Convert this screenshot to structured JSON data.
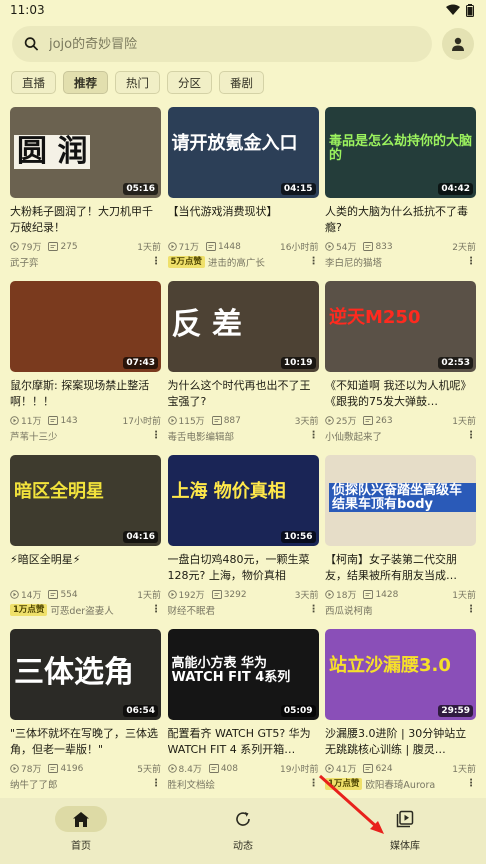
{
  "status": {
    "time": "11:03"
  },
  "search": {
    "placeholder": "jojo的奇妙冒险"
  },
  "chips": [
    "直播",
    "推荐",
    "热门",
    "分区",
    "番剧"
  ],
  "videos": [
    {
      "cap": "圆  润",
      "duration": "05:16",
      "title": "大粉耗子圆润了！大刀机甲千万破纪录！",
      "views": "79万",
      "comments": "275",
      "date": "1天前",
      "badge": "",
      "author": "武子弈",
      "bg": "#6b6250",
      "cap_color": "#111",
      "cap_bg": "#f4f1e6"
    },
    {
      "cap": "请开放氪金入口",
      "duration": "04:15",
      "title": "【当代游戏消费现状】",
      "views": "71万",
      "comments": "1448",
      "date": "16小时前",
      "badge": "5万点赞",
      "author": "进击的高广长",
      "bg": "#2c3f57",
      "cap_color": "#ffffff",
      "cap_bg": ""
    },
    {
      "cap": "毒品是怎么劫持你的大脑的",
      "duration": "04:42",
      "title": "人类的大脑为什么抵抗不了毒瘾?",
      "views": "54万",
      "comments": "833",
      "date": "2天前",
      "badge": "",
      "author": "李白尼的猫塔",
      "bg": "#243d3a",
      "cap_color": "#9bf25e",
      "cap_bg": ""
    },
    {
      "cap": "",
      "duration": "07:43",
      "title": "鼠尔摩斯: 探案现场禁止整活啊！！！",
      "views": "11万",
      "comments": "143",
      "date": "17小时前",
      "badge": "",
      "author": "芦苇十三少",
      "bg": "#7a3a1e",
      "cap_color": "#fff",
      "cap_bg": ""
    },
    {
      "cap": "反  差",
      "duration": "10:19",
      "title": "为什么这个时代再也出不了王宝强了?",
      "views": "115万",
      "comments": "887",
      "date": "3天前",
      "badge": "",
      "author": "毒舌电影编辑部",
      "bg": "#4d4234",
      "cap_color": "#ffffff",
      "cap_bg": ""
    },
    {
      "cap": "逆天M250",
      "duration": "02:53",
      "title": "《不知道啊 我还以为人机呢》《跟我的75发大弹鼓…",
      "views": "25万",
      "comments": "263",
      "date": "1天前",
      "badge": "",
      "author": "小仙敷起来了",
      "bg": "#5a5147",
      "cap_color": "#ff2a1f",
      "cap_bg": ""
    },
    {
      "cap": "暗区全明星",
      "duration": "04:16",
      "title": "⚡暗区全明星⚡",
      "views": "14万",
      "comments": "554",
      "date": "1天前",
      "badge": "1万点赞",
      "author": "可恶der盗妻人",
      "bg": "#3e3b2e",
      "cap_color": "#f2e33c",
      "cap_bg": ""
    },
    {
      "cap": "上海 物价真相",
      "duration": "10:56",
      "title": "一盘白切鸡480元，一颗生菜128元? 上海，物价真相",
      "views": "192万",
      "comments": "3292",
      "date": "3天前",
      "badge": "",
      "author": "财经不眠君",
      "bg": "#1a2556",
      "cap_color": "#ffe84a",
      "cap_bg": ""
    },
    {
      "cap": "侦探队兴奋踏坐高级车 结果车顶有body",
      "duration": "",
      "title": "【柯南】女子装第二代交朋友，结果被所有朋友当成…",
      "views": "18万",
      "comments": "1428",
      "date": "1天前",
      "badge": "",
      "author": "西瓜说柯南",
      "bg": "#e6ddc8",
      "cap_color": "#ffffff",
      "cap_bg": "#2a5ab8"
    },
    {
      "cap": "三体选角",
      "duration": "06:54",
      "title": "\"三体坏就坏在写晚了，三体选角，但老一辈版！\"",
      "views": "78万",
      "comments": "4196",
      "date": "5天前",
      "badge": "",
      "author": "纳牛了了郎",
      "bg": "#2b2a26",
      "cap_color": "#ffffff",
      "cap_bg": ""
    },
    {
      "cap": "高能小方表 华为WATCH FIT 4系列",
      "duration": "05:09",
      "title": "配置看齐 WATCH GT5? 华为WATCH FIT 4 系列开箱…",
      "views": "8.4万",
      "comments": "408",
      "date": "19小时前",
      "badge": "",
      "author": "胜利文档绘",
      "bg": "#151515",
      "cap_color": "#ffffff",
      "cap_bg": ""
    },
    {
      "cap": "站立沙漏腰3.0",
      "duration": "29:59",
      "title": "沙漏腰3.0进阶 | 30分钟站立无跳跳核心训练 | 腹灵…",
      "views": "41万",
      "comments": "624",
      "date": "1天前",
      "badge": "1万点赞",
      "author": "欧阳春琦Aurora",
      "bg": "#8a4fb8",
      "cap_color": "#f6e02a",
      "cap_bg": ""
    }
  ],
  "nav": [
    {
      "label": "首页",
      "icon": "home-icon"
    },
    {
      "label": "动态",
      "icon": "refresh-icon"
    },
    {
      "label": "媒体库",
      "icon": "media-library-icon"
    }
  ]
}
